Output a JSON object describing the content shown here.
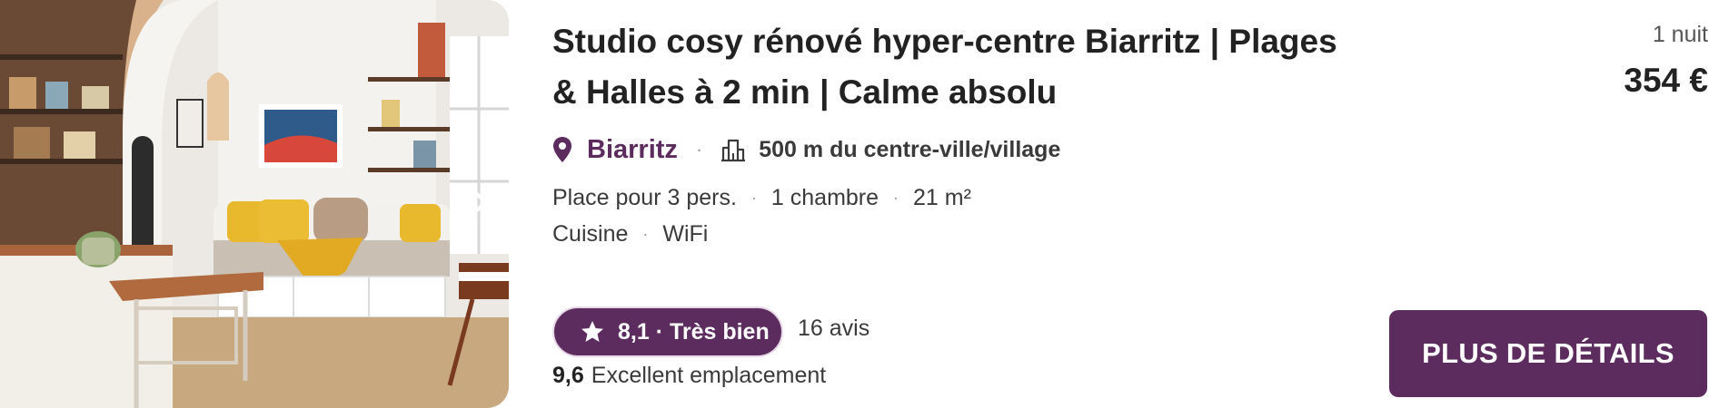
{
  "listing": {
    "title": "Studio cosy rénové hyper-centre Biarritz | Plages & Halles à 2 min | Calme absolu",
    "city": "Biarritz",
    "distance": "500 m du centre-ville/village",
    "facts": [
      "Place pour 3 pers.",
      "1 chambre",
      "21 m²"
    ],
    "amenities": [
      "Cuisine",
      "WiFi"
    ],
    "rating": "8,1 · Très bien",
    "reviews": "16 avis",
    "location_score": "9,6",
    "location_label": "Excellent emplacement"
  },
  "price": {
    "nights": "1 nuit",
    "amount": "354 €"
  },
  "cta": {
    "label": "PLUS DE DÉTAILS"
  },
  "icons": {
    "pin": "location-pin-icon",
    "building": "city-center-icon",
    "star": "star-icon",
    "next": "chevron-right-icon"
  },
  "colors": {
    "brand": "#5c2c5e",
    "text": "#222222",
    "muted": "#3a3a3a"
  }
}
